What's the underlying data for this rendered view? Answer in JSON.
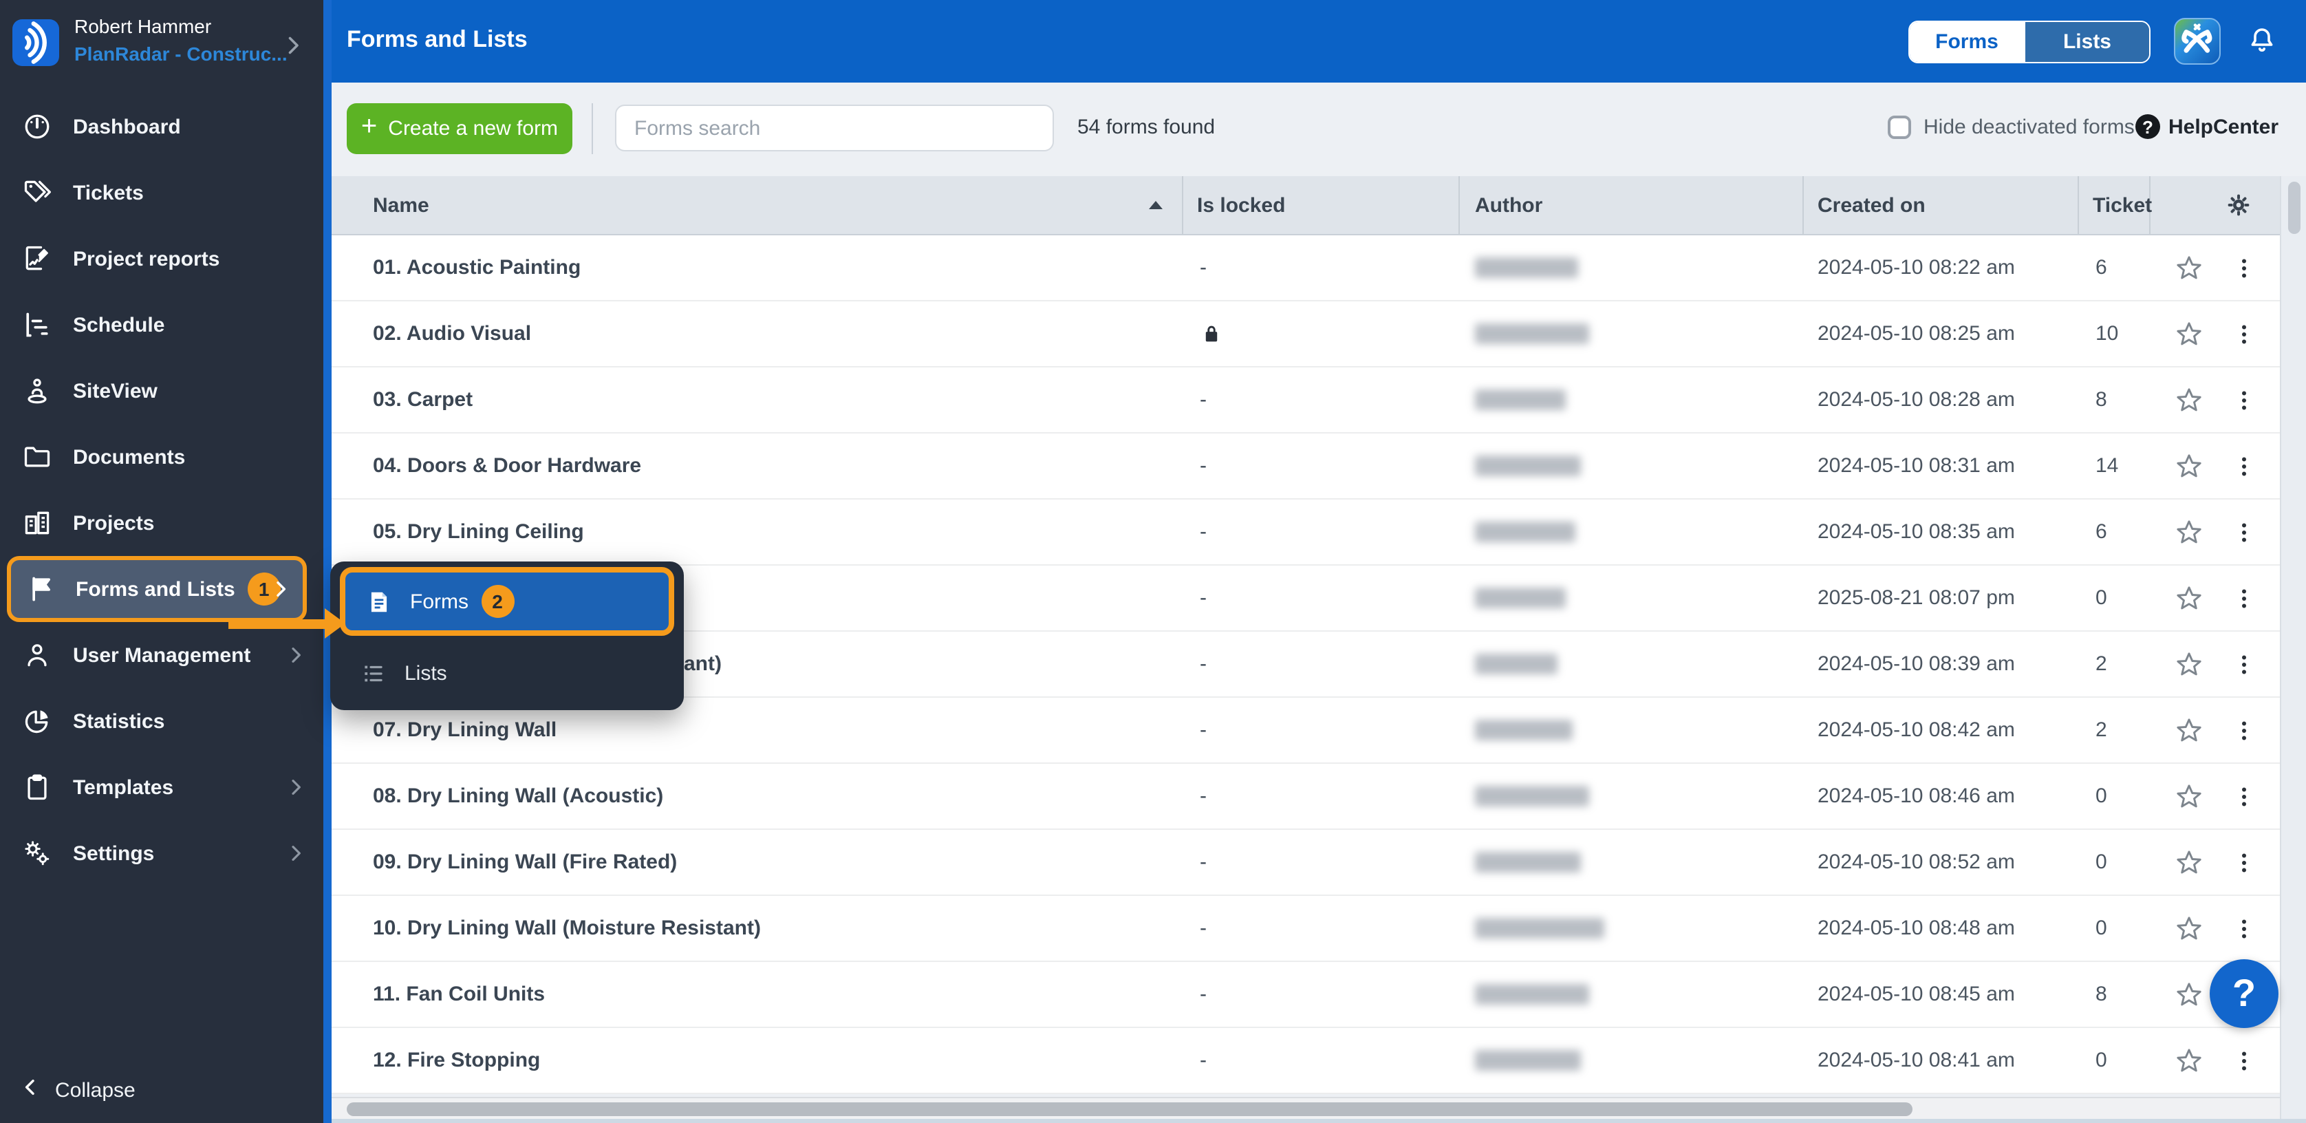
{
  "sidebar": {
    "user": {
      "name": "Robert Hammer",
      "account": "PlanRadar - Construc..."
    },
    "items": [
      {
        "label": "Dashboard"
      },
      {
        "label": "Tickets"
      },
      {
        "label": "Project reports"
      },
      {
        "label": "Schedule"
      },
      {
        "label": "SiteView"
      },
      {
        "label": "Documents"
      },
      {
        "label": "Projects"
      },
      {
        "label": "Forms and Lists",
        "badge": "1"
      },
      {
        "label": "User Management"
      },
      {
        "label": "Statistics"
      },
      {
        "label": "Templates"
      },
      {
        "label": "Settings"
      }
    ],
    "collapse_label": "Collapse"
  },
  "header": {
    "title": "Forms and Lists",
    "toggle": {
      "forms": "Forms",
      "lists": "Lists",
      "active": "Forms"
    }
  },
  "toolbar": {
    "create_plus": "+",
    "create_button": "Create a new form",
    "search_placeholder": "Forms search",
    "results_count": "54 forms found",
    "hide_deactivated_label": "Hide deactivated forms",
    "help_badge": "?",
    "help_label": "HelpCenter"
  },
  "popup": {
    "items": [
      {
        "label": "Forms",
        "badge": "2",
        "active": true
      },
      {
        "label": "Lists",
        "active": false
      }
    ]
  },
  "table": {
    "columns": {
      "name": "Name",
      "locked": "Is locked",
      "author": "Author",
      "created": "Created on",
      "ticket": "Ticket"
    },
    "rows": [
      {
        "name": "01. Acoustic Painting",
        "locked": "-",
        "created": "2024-05-10 08:22 am",
        "tickets": "6"
      },
      {
        "name": "02. Audio Visual",
        "locked": "locked",
        "created": "2024-05-10 08:25 am",
        "tickets": "10"
      },
      {
        "name": "03. Carpet",
        "locked": "-",
        "created": "2024-05-10 08:28 am",
        "tickets": "8"
      },
      {
        "name": "04. Doors & Door Hardware",
        "locked": "-",
        "created": "2024-05-10 08:31 am",
        "tickets": "14"
      },
      {
        "name": "05. Dry Lining Ceiling",
        "locked": "-",
        "created": "2024-05-10 08:35 am",
        "tickets": "6"
      },
      {
        "name": "",
        "locked": "-",
        "created": "2025-08-21 08:07 pm",
        "tickets": "0"
      },
      {
        "name": "ant)",
        "locked": "-",
        "created": "2024-05-10 08:39 am",
        "tickets": "2"
      },
      {
        "name": "07. Dry Lining Wall",
        "locked": "-",
        "created": "2024-05-10 08:42 am",
        "tickets": "2"
      },
      {
        "name": "08. Dry Lining Wall (Acoustic)",
        "locked": "-",
        "created": "2024-05-10 08:46 am",
        "tickets": "0"
      },
      {
        "name": "09. Dry Lining Wall (Fire Rated)",
        "locked": "-",
        "created": "2024-05-10 08:52 am",
        "tickets": "0"
      },
      {
        "name": "10. Dry Lining Wall (Moisture Resistant)",
        "locked": "-",
        "created": "2024-05-10 08:48 am",
        "tickets": "0"
      },
      {
        "name": "11. Fan Coil Units",
        "locked": "-",
        "created": "2024-05-10 08:45 am",
        "tickets": "8"
      },
      {
        "name": "12. Fire Stopping",
        "locked": "-",
        "created": "2024-05-10 08:41 am",
        "tickets": "0"
      }
    ]
  },
  "floating": {
    "help_label": "?"
  },
  "colors": {
    "header_blue": "#0b62c6",
    "sidebar_dark": "#272f3d",
    "accent_orange": "#f59b1c",
    "create_green": "#5cb324",
    "active_popup_blue": "#1c62b4"
  }
}
